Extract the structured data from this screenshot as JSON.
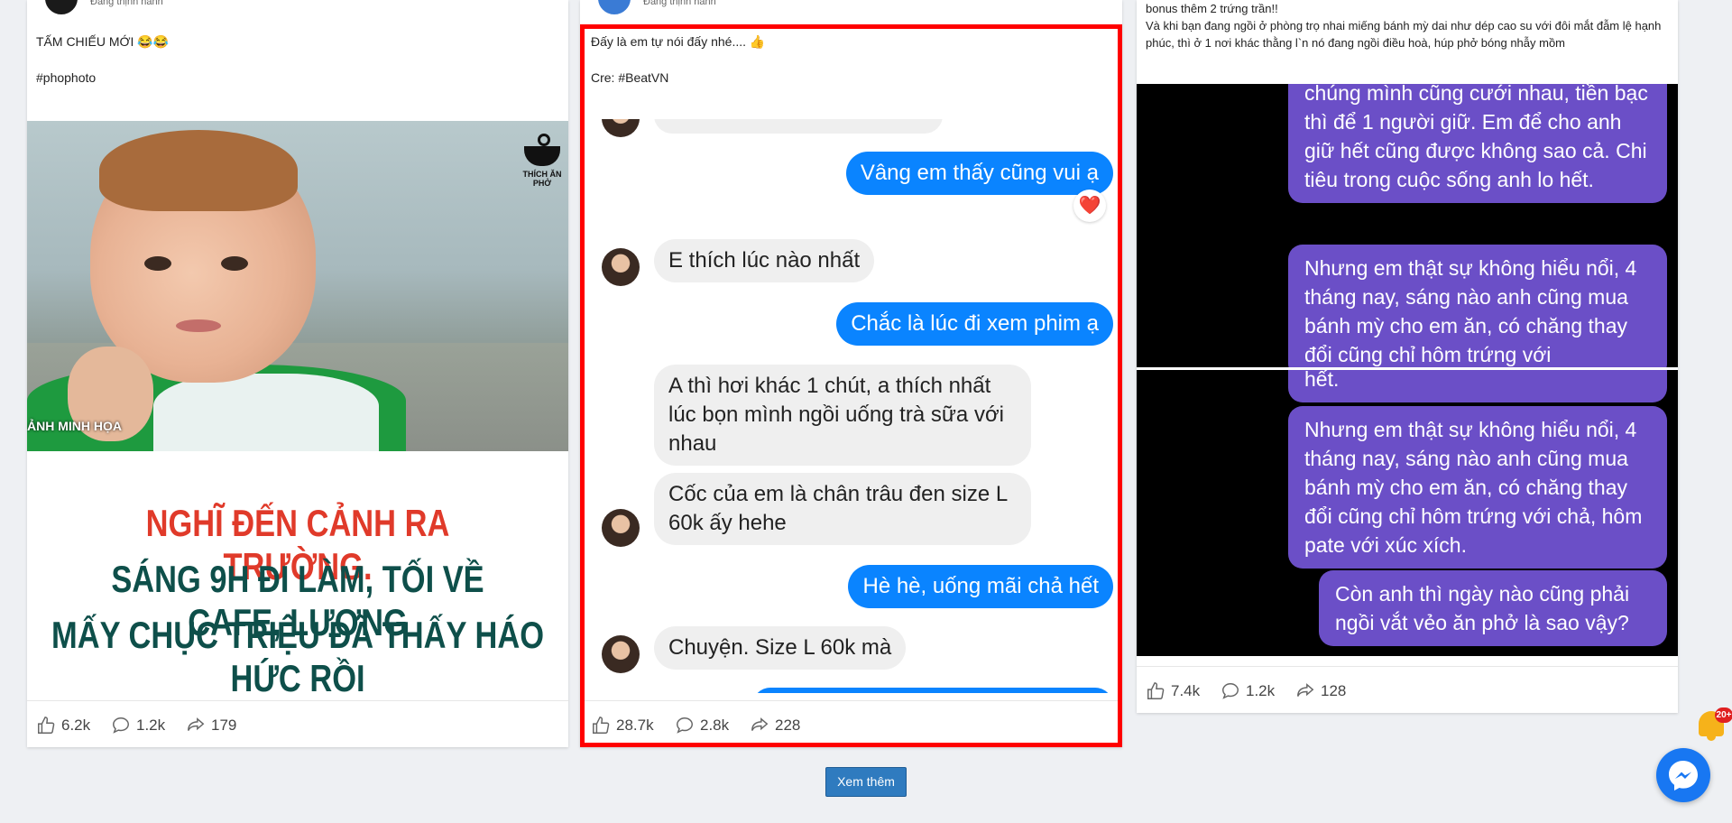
{
  "posts": [
    {
      "header_sub": "Đang thịnh hành",
      "caption_line1": "TẤM CHIẾU MỚI 😂😂",
      "caption_line2": "#phophoto",
      "image": {
        "watermark": "THÍCH ĂN PHỞ",
        "overlay": "ẢNH MINH HỌA",
        "headline": [
          "NGHĨ ĐẾN CẢNH RA TRƯỜNG.",
          "SÁNG 9H ĐI LÀM, TỐI VỀ CAFE, LƯƠNG",
          "MẤY CHỤC TRIỆU ĐÃ THẤY HÁO HỨC RỒI"
        ]
      },
      "stats": {
        "likes": "6.2k",
        "comments": "1.2k",
        "shares": "179"
      }
    },
    {
      "header_sub": "Đang thịnh hành",
      "caption_line1": "Đấy là em tự nói đấy nhé.... 👍",
      "caption_line2": "Cre: #BeatVN",
      "chat": [
        {
          "dir": "out",
          "text": "Vâng em thấy cũng vui ạ",
          "reaction": "❤️"
        },
        {
          "dir": "in",
          "text": "E thích lúc nào nhất"
        },
        {
          "dir": "out",
          "text": "Chắc là lúc đi xem phim ạ"
        },
        {
          "dir": "in",
          "text": "A thì hơi khác 1 chút, a thích nhất lúc bọn mình ngồi uống trà sữa với nhau"
        },
        {
          "dir": "in",
          "text": "Cốc của em là chân trâu đen size L 60k ấy hehe"
        },
        {
          "dir": "out",
          "text": "Hè hè, uống mãi chả hết"
        },
        {
          "dir": "in",
          "text": "Chuyện. Size L 60k mà"
        }
      ],
      "stats": {
        "likes": "28.7k",
        "comments": "2.8k",
        "shares": "228"
      }
    },
    {
      "caption_line1": "bonus thêm 2 trứng trần!!",
      "caption_line2": "Và khi bạn đang ngồi ở phòng trọ nhai miếng bánh mỳ dai như dép cao su với đôi mắt đẫm lệ hạnh phúc, thì ở 1 nơi khác thằng l`n nó đang ngồi điều hoà, húp phở bóng nhẫy mồm",
      "panels": [
        [
          "chúng mình cũng cưới nhau, tiền bạc thì để 1 người giữ. Em để cho anh giữ hết cũng được không sao cả. Chi tiêu trong cuộc sống anh lo hết.",
          "Nhưng em thật sự không hiểu nổi, 4 tháng nay, sáng nào anh cũng mua bánh mỳ cho em ăn, có chăng thay đổi cũng chỉ hôm trứng với"
        ],
        [
          "hết.",
          "Nhưng em thật sự không hiểu nổi, 4 tháng nay, sáng nào anh cũng mua bánh mỳ cho em ăn, có chăng thay đổi cũng chỉ hôm trứng với chả, hôm pate với xúc xích.",
          "Còn anh thì ngày nào cũng phải ngồi vắt vẻo ăn phở là sao vậy?"
        ]
      ],
      "stats": {
        "likes": "7.4k",
        "comments": "1.2k",
        "shares": "128"
      }
    }
  ],
  "load_more": "Xem thêm",
  "notification_badge": "20+",
  "colors": {
    "accent": "#2f7bbf",
    "highlight": "#ff0000",
    "messenger": "#1877f2",
    "bubble_out": "#0a84ff",
    "bubble_purple": "#6b4fc7"
  }
}
